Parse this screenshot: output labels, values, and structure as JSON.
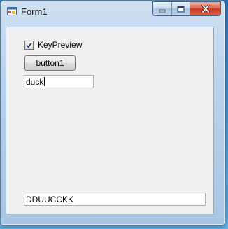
{
  "window": {
    "title": "Form1"
  },
  "form": {
    "checkbox_label": "KeyPreview",
    "checkbox_checked": true,
    "button_label": "button1",
    "top_textbox_value": "duck",
    "bottom_textbox_value": "DDUUCCKK"
  },
  "icons": {
    "app": "form-app-icon",
    "minimize": "minimize-icon",
    "maximize": "maximize-icon",
    "close": "close-icon",
    "check": "checkmark-icon"
  }
}
